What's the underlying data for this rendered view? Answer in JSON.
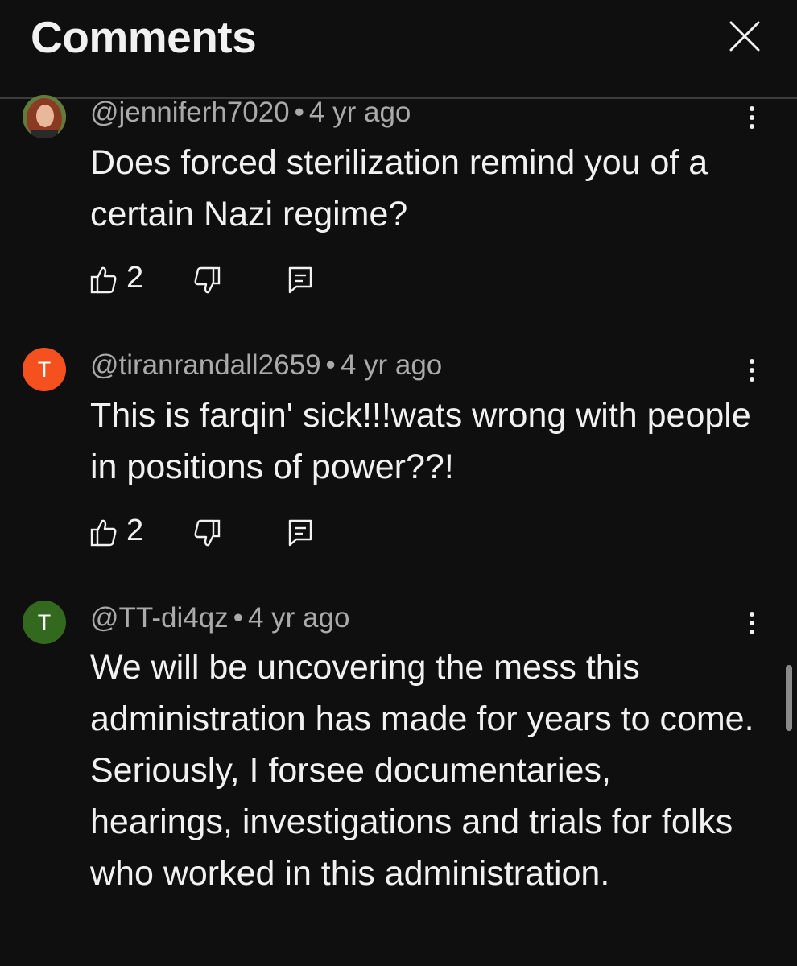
{
  "header": {
    "title": "Comments",
    "close_icon": "close-icon"
  },
  "comments": [
    {
      "author": "@jenniferh7020",
      "separator": "•",
      "time": "4 yr ago",
      "text": "Does forced sterilization remind you of a certain Nazi regime?",
      "likes": "2",
      "avatar": {
        "type": "photo",
        "initial": "",
        "color": "#8a5a3c"
      }
    },
    {
      "author": "@tiranrandall2659",
      "separator": "•",
      "time": "4 yr ago",
      "text": "This is farqin' sick!!!wats wrong with people in positions of power??!",
      "likes": "2",
      "avatar": {
        "type": "initial",
        "initial": "T",
        "color": "#f4511e"
      }
    },
    {
      "author": "@TT-di4qz",
      "separator": "•",
      "time": "4 yr ago",
      "text": "We will be uncovering the mess this administration has made for years to come.  Seriously,  I forsee documentaries,  hearings, investigations and trials for folks who worked in this administration.",
      "likes": "",
      "avatar": {
        "type": "initial",
        "initial": "T",
        "color": "#33691e"
      }
    }
  ],
  "colors": {
    "background": "#0f0f0f",
    "text_primary": "#f1f1f1",
    "text_secondary": "#aaaaaa",
    "divider": "#3d3d3d"
  }
}
